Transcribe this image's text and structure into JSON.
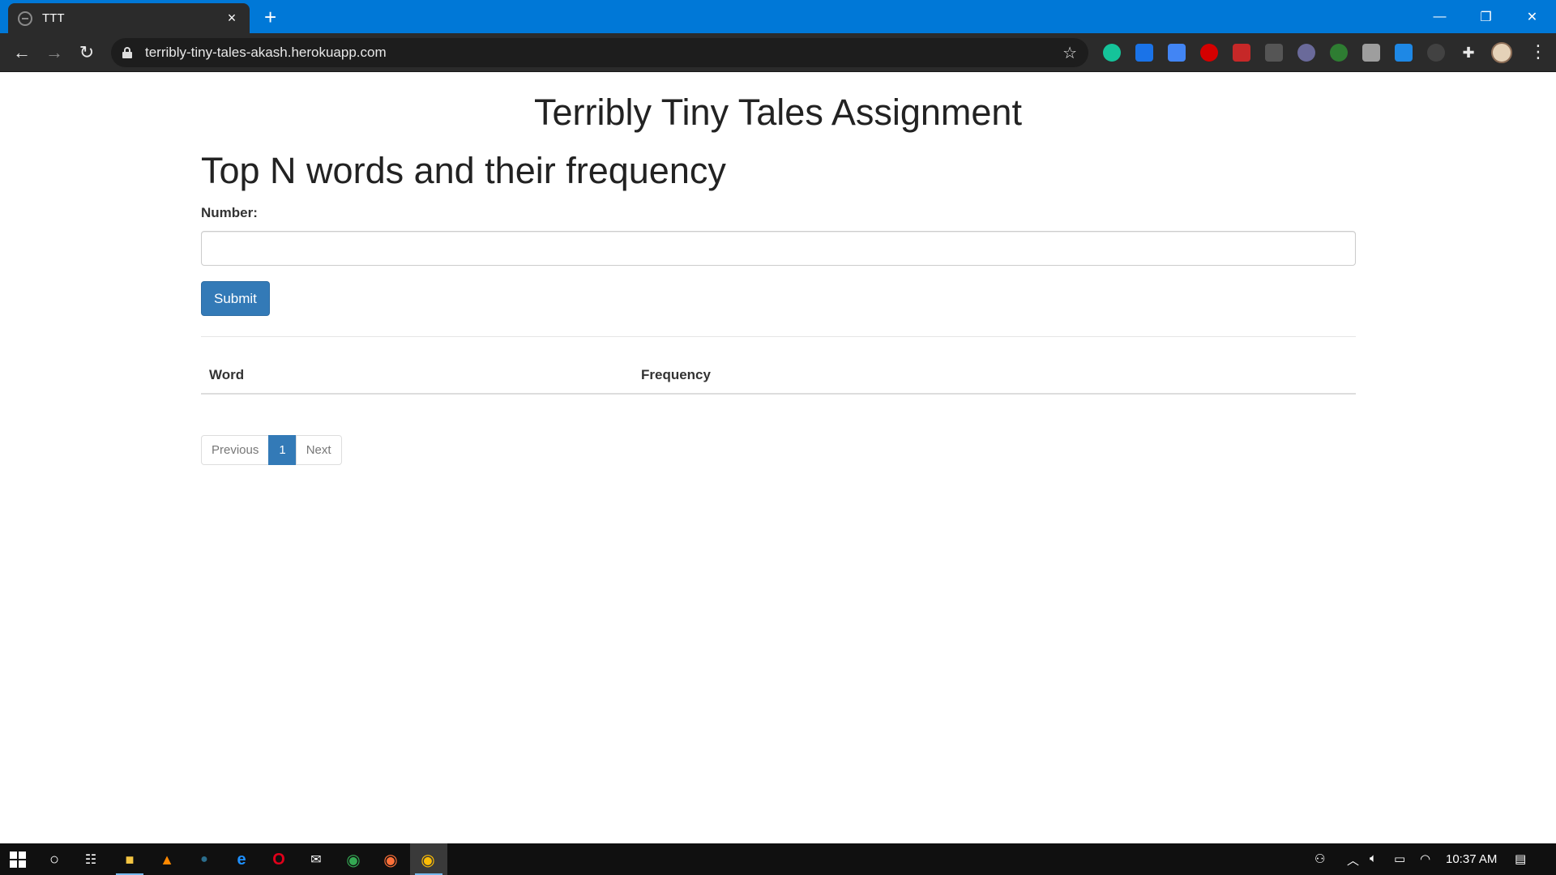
{
  "browser": {
    "tab_title": "TTT",
    "tab_close": "×",
    "new_tab": "+",
    "url": "terribly-tiny-tales-akash.herokuapp.com",
    "window_controls": {
      "minimize": "—",
      "restore": "❐",
      "close": "✕"
    },
    "nav": {
      "back": "←",
      "forward": "→",
      "reload": "↻"
    },
    "bookmark_star": "☆",
    "menu": "⋮"
  },
  "page": {
    "title": "Terribly Tiny Tales Assignment",
    "section_title": "Top N words and their frequency",
    "form": {
      "label": "Number:",
      "input_value": "",
      "input_placeholder": "",
      "submit_label": "Submit"
    },
    "table": {
      "columns": [
        "Word",
        "Frequency"
      ],
      "rows": []
    },
    "pagination": {
      "previous": "Previous",
      "current_page": "1",
      "next": "Next"
    }
  },
  "taskbar": {
    "time": "10:37 AM"
  },
  "colors": {
    "titlebar": "#0078d7",
    "toolbar": "#2b2b2b",
    "primary": "#337ab7",
    "taskbar": "#101010"
  }
}
